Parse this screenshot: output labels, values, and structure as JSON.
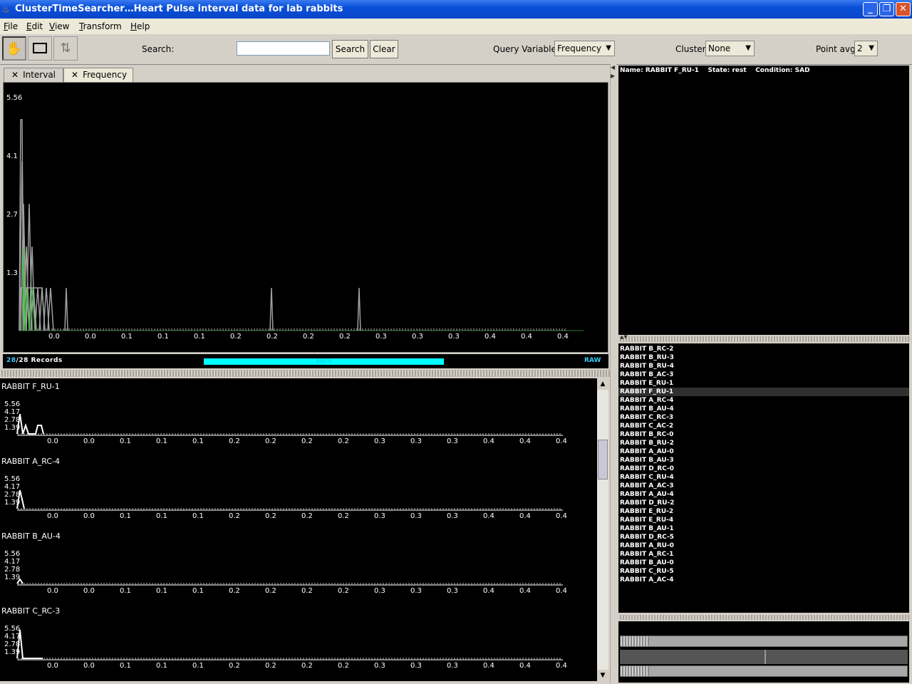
{
  "window": {
    "title": "ClusterTimeSearcher…Heart Pulse interval data for lab rabbits",
    "controls": [
      "_",
      "❐",
      "✕"
    ]
  },
  "menu": [
    "File",
    "Edit",
    "View",
    "Transform",
    "Help"
  ],
  "toolbar": {
    "search_label": "Search:",
    "search_value": "",
    "search_button": "Search",
    "clear_button": "Clear",
    "query_variable_label": "Query Variable",
    "query_variable_value": "Frequency",
    "cluster_label": "Cluster",
    "cluster_value": "None",
    "point_avg_label": "Point avg",
    "point_avg_value": "2",
    "icons": [
      "hand-icon",
      "rectangle-icon",
      "sort-icon"
    ]
  },
  "tabs": [
    {
      "label": "Interval",
      "close": "✕"
    },
    {
      "label": "Frequency",
      "close": "✕"
    }
  ],
  "main_chart": {
    "y_ticks": [
      "5.56",
      "4.1",
      "2.7",
      "1.3"
    ],
    "x_ticks": [
      "0.0",
      "0.0",
      "0.1",
      "0.1",
      "0.1",
      "0.2",
      "0.2",
      "0.2",
      "0.2",
      "0.3",
      "0.3",
      "0.3",
      "0.4",
      "0.4",
      "0.4"
    ],
    "colors": {
      "series": "#a0a0a0",
      "highlight": "#33cc33",
      "axis": "#ffffff"
    }
  },
  "status": {
    "records_current": "28",
    "records_total": "/28 Records",
    "progress_label": "100%",
    "progress_fraction": 1.0,
    "mode": "RAW"
  },
  "mini_charts": [
    {
      "name": "RABBIT F_RU-1",
      "y_ticks": [
        "5.56",
        "4.17",
        "2.78",
        "1.39"
      ],
      "x_ticks": [
        "0.0",
        "0.0",
        "0.1",
        "0.1",
        "0.1",
        "0.2",
        "0.2",
        "0.2",
        "0.2",
        "0.3",
        "0.3",
        "0.3",
        "0.4",
        "0.4",
        "0.4"
      ]
    },
    {
      "name": "RABBIT A_RC-4",
      "y_ticks": [
        "5.56",
        "4.17",
        "2.78",
        "1.39"
      ],
      "x_ticks": [
        "0.0",
        "0.0",
        "0.1",
        "0.1",
        "0.1",
        "0.2",
        "0.2",
        "0.2",
        "0.2",
        "0.3",
        "0.3",
        "0.3",
        "0.4",
        "0.4",
        "0.4"
      ]
    },
    {
      "name": "RABBIT B_AU-4",
      "y_ticks": [
        "5.56",
        "4.17",
        "2.78",
        "1.39"
      ],
      "x_ticks": [
        "0.0",
        "0.0",
        "0.1",
        "0.1",
        "0.1",
        "0.2",
        "0.2",
        "0.2",
        "0.2",
        "0.3",
        "0.3",
        "0.3",
        "0.4",
        "0.4",
        "0.4"
      ]
    },
    {
      "name": "RABBIT C_RC-3",
      "y_ticks": [
        "5.56",
        "4.17",
        "2.78",
        "1.39"
      ],
      "x_ticks": [
        "0.0",
        "0.0",
        "0.1",
        "0.1",
        "0.1",
        "0.2",
        "0.2",
        "0.2",
        "0.2",
        "0.3",
        "0.3",
        "0.3",
        "0.4",
        "0.4",
        "0.4"
      ]
    }
  ],
  "info": {
    "text": "Name: RABBIT F_RU-1    State: rest    Condition: SAD"
  },
  "record_list": {
    "selected_index": 5,
    "items": [
      "RABBIT B_RC-2",
      "RABBIT B_RU-3",
      "RABBIT B_RU-4",
      "RABBIT B_AC-3",
      "RABBIT E_RU-1",
      "RABBIT F_RU-1",
      "RABBIT A_RC-4",
      "RABBIT B_AU-4",
      "RABBIT C_RC-3",
      "RABBIT C_AC-2",
      "RABBIT B_RC-0",
      "RABBIT B_RU-2",
      "RABBIT A_AU-0",
      "RABBIT B_AU-3",
      "RABBIT D_RC-0",
      "RABBIT C_RU-4",
      "RABBIT A_AC-3",
      "RABBIT A_AU-4",
      "RABBIT D_RU-2",
      "RABBIT E_RU-2",
      "RABBIT E_RU-4",
      "RABBIT B_AU-1",
      "RABBIT D_RC-5",
      "RABBIT A_RU-0",
      "RABBIT A_RC-1",
      "RABBIT B_AU-0",
      "RABBIT C_RU-5",
      "RABBIT A_AC-4"
    ]
  }
}
